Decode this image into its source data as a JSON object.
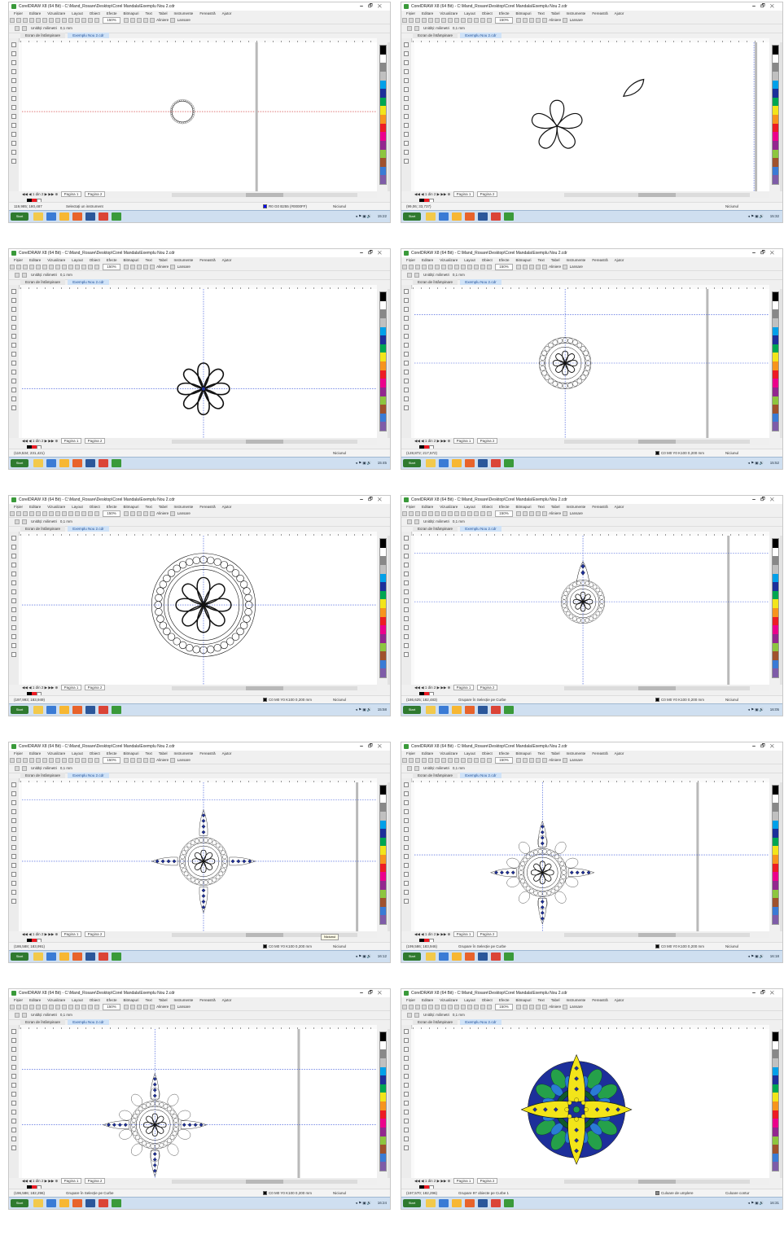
{
  "app": {
    "title": "CorelDRAW X8 (64 Bit) - C:\\Mand_Rosare\\Desktop\\Corel Mandala\\Exemplu Nou 2.cdr",
    "menus": [
      "Fișier",
      "Editare",
      "Vizualizare",
      "Layout",
      "Obiect",
      "Efecte",
      "Bitmapuri",
      "Text",
      "Tabel",
      "Instrumente",
      "Fereastră",
      "Ajutor"
    ],
    "zoom": "150%",
    "align_label": "Aliniere",
    "launch_label": "Lansare",
    "units_label": "Unități: milimetri",
    "nudge": "0,1 mm",
    "doc_tabs": [
      "Ecran de întâmpinare",
      "Exemplu Nou 2.cdr"
    ],
    "page_label": "Pagina 1",
    "page2_label": "Pagina 2",
    "snap_label": "Niciunul",
    "colors": {
      "accent": "#1d4f9a",
      "guide_blue": "#2a48d6",
      "guide_red": "#cc2222",
      "mandala_blue": "#1d2f9a",
      "mandala_green": "#25a04a",
      "mandala_yellow": "#f2e51a",
      "mandala_lightblue": "#2a7bd4",
      "mandala_darkgreen": "#0f5a2b"
    },
    "palette": [
      "#000000",
      "#ffffff",
      "#888888",
      "#c0c0c0",
      "#00a0e9",
      "#1d2f9a",
      "#00a651",
      "#f2e51a",
      "#f7941d",
      "#ed1c24",
      "#ec008c",
      "#92278f",
      "#8dc63f",
      "#a0522d",
      "#3a7bd5",
      "#7e5ca8"
    ]
  },
  "screens": [
    {
      "coords": "119,985; 180,487",
      "status": "Selectați un instrument",
      "fill": "R0 G0 B255 (#0000FF)",
      "outline": "Niciunul",
      "clock": "15:22"
    },
    {
      "coords": "(99,06; 33,737)",
      "status": "",
      "fill": "",
      "outline": "Niciunul",
      "clock": "15:32"
    },
    {
      "coords": "(119,534; 231,421)",
      "status": "",
      "fill": "",
      "outline": "Niciunul",
      "clock": "15:45"
    },
    {
      "coords": "(128,872; 217,572)",
      "status": "",
      "fill": "C0 M0 Y0 K100 0,200 mm",
      "outline": "Niciunul",
      "clock": "15:52"
    },
    {
      "coords": "(197,993; 183,949)",
      "status": "",
      "fill": "C0 M0 Y0 K100 0,200 mm",
      "outline": "Niciunul",
      "clock": "15:58"
    },
    {
      "coords": "(186,625; 182,483)",
      "status": "Grupare în Selecție pe Curbe",
      "fill": "C0 M0 Y0 K100 0,200 mm",
      "outline": "Niciunul",
      "clock": "16:05"
    },
    {
      "coords": "(186,588; 183,991)",
      "status": "",
      "fill": "C0 M0 Y0 K100 0,200 mm",
      "outline": "Niciunul",
      "clock": "16:12",
      "tooltip": "Niciunul"
    },
    {
      "coords": "(199,586; 183,946)",
      "status": "Grupare în Selecție pe Curbe",
      "fill": "C0 M0 Y0 K100 0,200 mm",
      "outline": "Niciunul",
      "clock": "16:18"
    },
    {
      "coords": "(196,586; 182,296)",
      "status": "Grupare în Selecție pe Curbe",
      "fill": "C0 M0 Y0 K100 0,200 mm",
      "outline": "Niciunul",
      "clock": "16:24"
    },
    {
      "coords": "(197,570; 182,296)",
      "status": "Grupare 97 obiecte pe Curbe 1",
      "fill": "Culoare de umplere",
      "outline": "Culoare contur",
      "clock": "16:31"
    }
  ]
}
